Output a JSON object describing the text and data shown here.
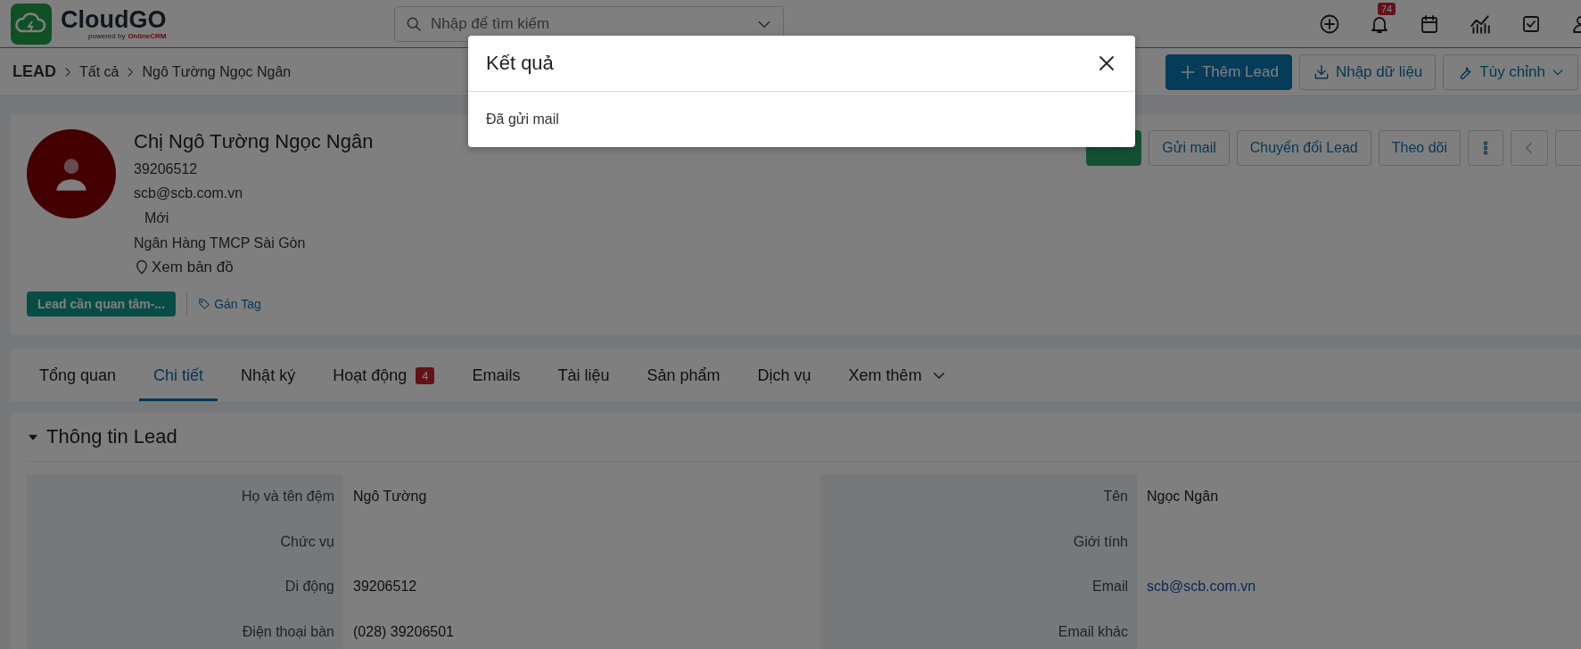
{
  "header": {
    "logo": {
      "name": "CloudGO",
      "tagline": "powered by",
      "brand": "OnlineCRM"
    },
    "search": {
      "placeholder": "Nhập để tìm kiếm"
    },
    "notifications_badge": "74"
  },
  "breadcrumb": [
    "LEAD",
    "Tất cả",
    "Ngô Tường Ngọc Ngân"
  ],
  "toolbar_buttons": [
    {
      "label": "Thêm Lead",
      "kind": "primary"
    },
    {
      "label": "Nhập dữ liệu",
      "kind": "import"
    },
    {
      "label": "Tùy chỉnh",
      "kind": "menu"
    }
  ],
  "lead": {
    "name": "Chị Ngô Tường Ngọc Ngân",
    "phone": "39206512",
    "email": "scb@scb.com.vn",
    "status": "Mới",
    "company": "Ngân Hàng TMCP Sài Gòn",
    "map_link": "Xem bản đồ",
    "tag": "Lead cần quan tâm-...",
    "assign_tag": "Gán Tag",
    "actions": [
      {
        "kind": "success"
      },
      {
        "kind": "outline",
        "label": "Gửi mail"
      },
      {
        "kind": "outline",
        "label": "Chuyển đổi Lead"
      },
      {
        "kind": "outline",
        "label": "Theo dõi"
      },
      {
        "kind": "more"
      },
      {
        "kind": "prev"
      },
      {
        "kind": "next"
      }
    ]
  },
  "tabs": [
    {
      "label": "Tổng quan",
      "selected": false,
      "kind": "tab"
    },
    {
      "label": "Chi tiết",
      "selected": true,
      "kind": "tab"
    },
    {
      "label": "Nhật ký",
      "selected": false,
      "kind": "tab"
    },
    {
      "label": "Hoạt động",
      "selected": false,
      "kind": "tab",
      "badge": "4"
    },
    {
      "label": "Emails",
      "selected": false,
      "kind": "tab"
    },
    {
      "label": "Tài liệu",
      "selected": false,
      "kind": "tab"
    },
    {
      "label": "Sản phẩm",
      "selected": false,
      "kind": "tab"
    },
    {
      "label": "Dịch vụ",
      "selected": false,
      "kind": "tab"
    },
    {
      "label": "Xem thêm",
      "selected": false,
      "kind": "menu"
    }
  ],
  "section": {
    "title": "Thông tin Lead",
    "expanded": true,
    "fields": [
      {
        "label": "Họ và tên đệm",
        "value": "Ngô Tường",
        "kind": "text"
      },
      {
        "label": "Tên",
        "value": "Ngọc Ngân",
        "kind": "text"
      },
      {
        "label": "Chức vụ",
        "kind": "text"
      },
      {
        "label": "Giới tính",
        "kind": "text"
      },
      {
        "label": "Di động",
        "value": "39206512",
        "kind": "text"
      },
      {
        "label": "Email",
        "value": "scb@scb.com.vn",
        "kind": "link"
      },
      {
        "label": "Điện thoại bàn",
        "value": "(028) 39206501",
        "kind": "text"
      },
      {
        "label": "Email khác",
        "kind": "text"
      }
    ]
  },
  "modal": {
    "title": "Kết quả",
    "message": "Đã gửi mail"
  }
}
